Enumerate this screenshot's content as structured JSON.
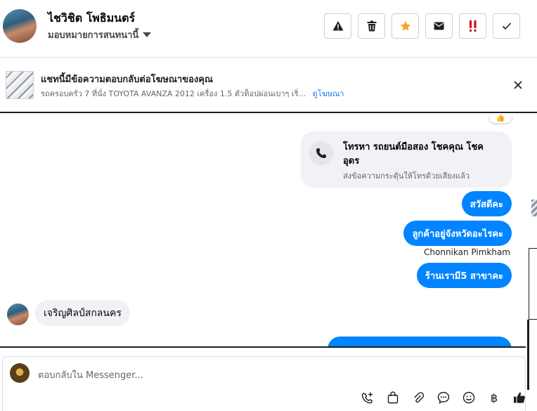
{
  "header": {
    "name": "ไชวิชิต โพธิมนตร์",
    "assign_label": "มอบหมายการสนทนานี้",
    "action_buttons": [
      {
        "name": "report-button",
        "icon": "warning-icon"
      },
      {
        "name": "delete-button",
        "icon": "trash-icon"
      },
      {
        "name": "star-button",
        "icon": "star-icon"
      },
      {
        "name": "mark-unread-button",
        "icon": "envelope-icon"
      },
      {
        "name": "spam-button",
        "icon": "exclamation-icon"
      },
      {
        "name": "mark-done-button",
        "icon": "check-icon"
      }
    ]
  },
  "ad_banner": {
    "title": "แชทนี้มีข้อความตอบกลับต่อโฆษณาของคุณ",
    "subtitle": "รถครอบครัว 7 ที่นั่ง TOYOTA AVANZA 2012 เครื่อง 1.5 ตัวท็อปผ่อนเบาๆ เริ่...",
    "link": "ดูโฆษณา"
  },
  "chat": {
    "call_card": {
      "title": "โทรหา รถยนต์มือสอง โชคคุณ โชค อุดร",
      "subtitle": "ส่งข้อความกระตุ้นให้โทรด้วยเสียงแล้ว"
    },
    "outgoing": [
      "สวัสดีคะ",
      "ลูกค้าอยู่จังหวัดอะไรคะ",
      "ร้านเรามี5 สาขาคะ"
    ],
    "sender_name": "Chonnikan Pimkham",
    "incoming": [
      "เจริญศิลป์สกลนคร"
    ]
  },
  "composer": {
    "placeholder": "ตอบกลับใน Messenger..."
  },
  "colors": {
    "accent": "#0084ff",
    "star": "#f5a623",
    "spam": "#d0021b"
  }
}
